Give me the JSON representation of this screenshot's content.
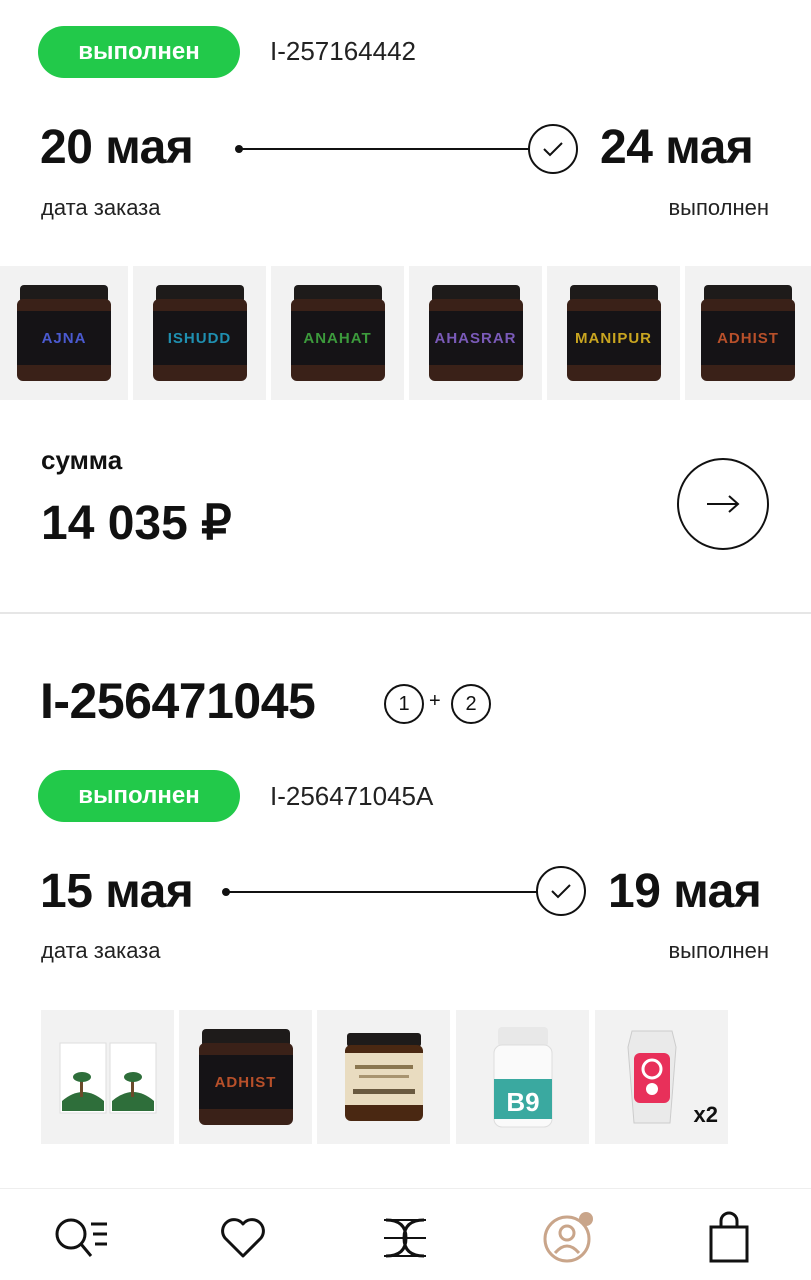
{
  "order1": {
    "status": "выполнен",
    "sub_id": "I-257164442",
    "order_date": "20 мая",
    "order_date_caption": "дата заказа",
    "done_date": "24 мая",
    "done_caption": "выполнен",
    "products": [
      {
        "label": "AJNA",
        "color": "#4a5ad0"
      },
      {
        "label": "ISHUDD",
        "color": "#1f8fb0"
      },
      {
        "label": "ANAHAT",
        "color": "#3c9a3c"
      },
      {
        "label": "AHASRAR",
        "color": "#7a5ab8"
      },
      {
        "label": "MANIPUR",
        "color": "#c9a520"
      },
      {
        "label": "ADHIST",
        "color": "#b8502a"
      }
    ],
    "sum_label": "сумма",
    "sum_value": "14 035 ₽"
  },
  "order2": {
    "id": "I-256471045",
    "part_a": "1",
    "part_plus": "+",
    "part_b": "2",
    "status": "выполнен",
    "sub_id": "I-256471045A",
    "order_date": "15 мая",
    "order_date_caption": "дата заказа",
    "done_date": "19 мая",
    "done_caption": "выполнен",
    "product_quantity_badge": "x2"
  },
  "bottom_nav": {
    "icons": [
      "search-catalog-icon",
      "heart-icon",
      "brand-logo-icon",
      "profile-icon",
      "cart-icon"
    ],
    "notification_color": "#c9a58a"
  },
  "colors": {
    "status_green": "#22c94a",
    "text": "#111111"
  }
}
